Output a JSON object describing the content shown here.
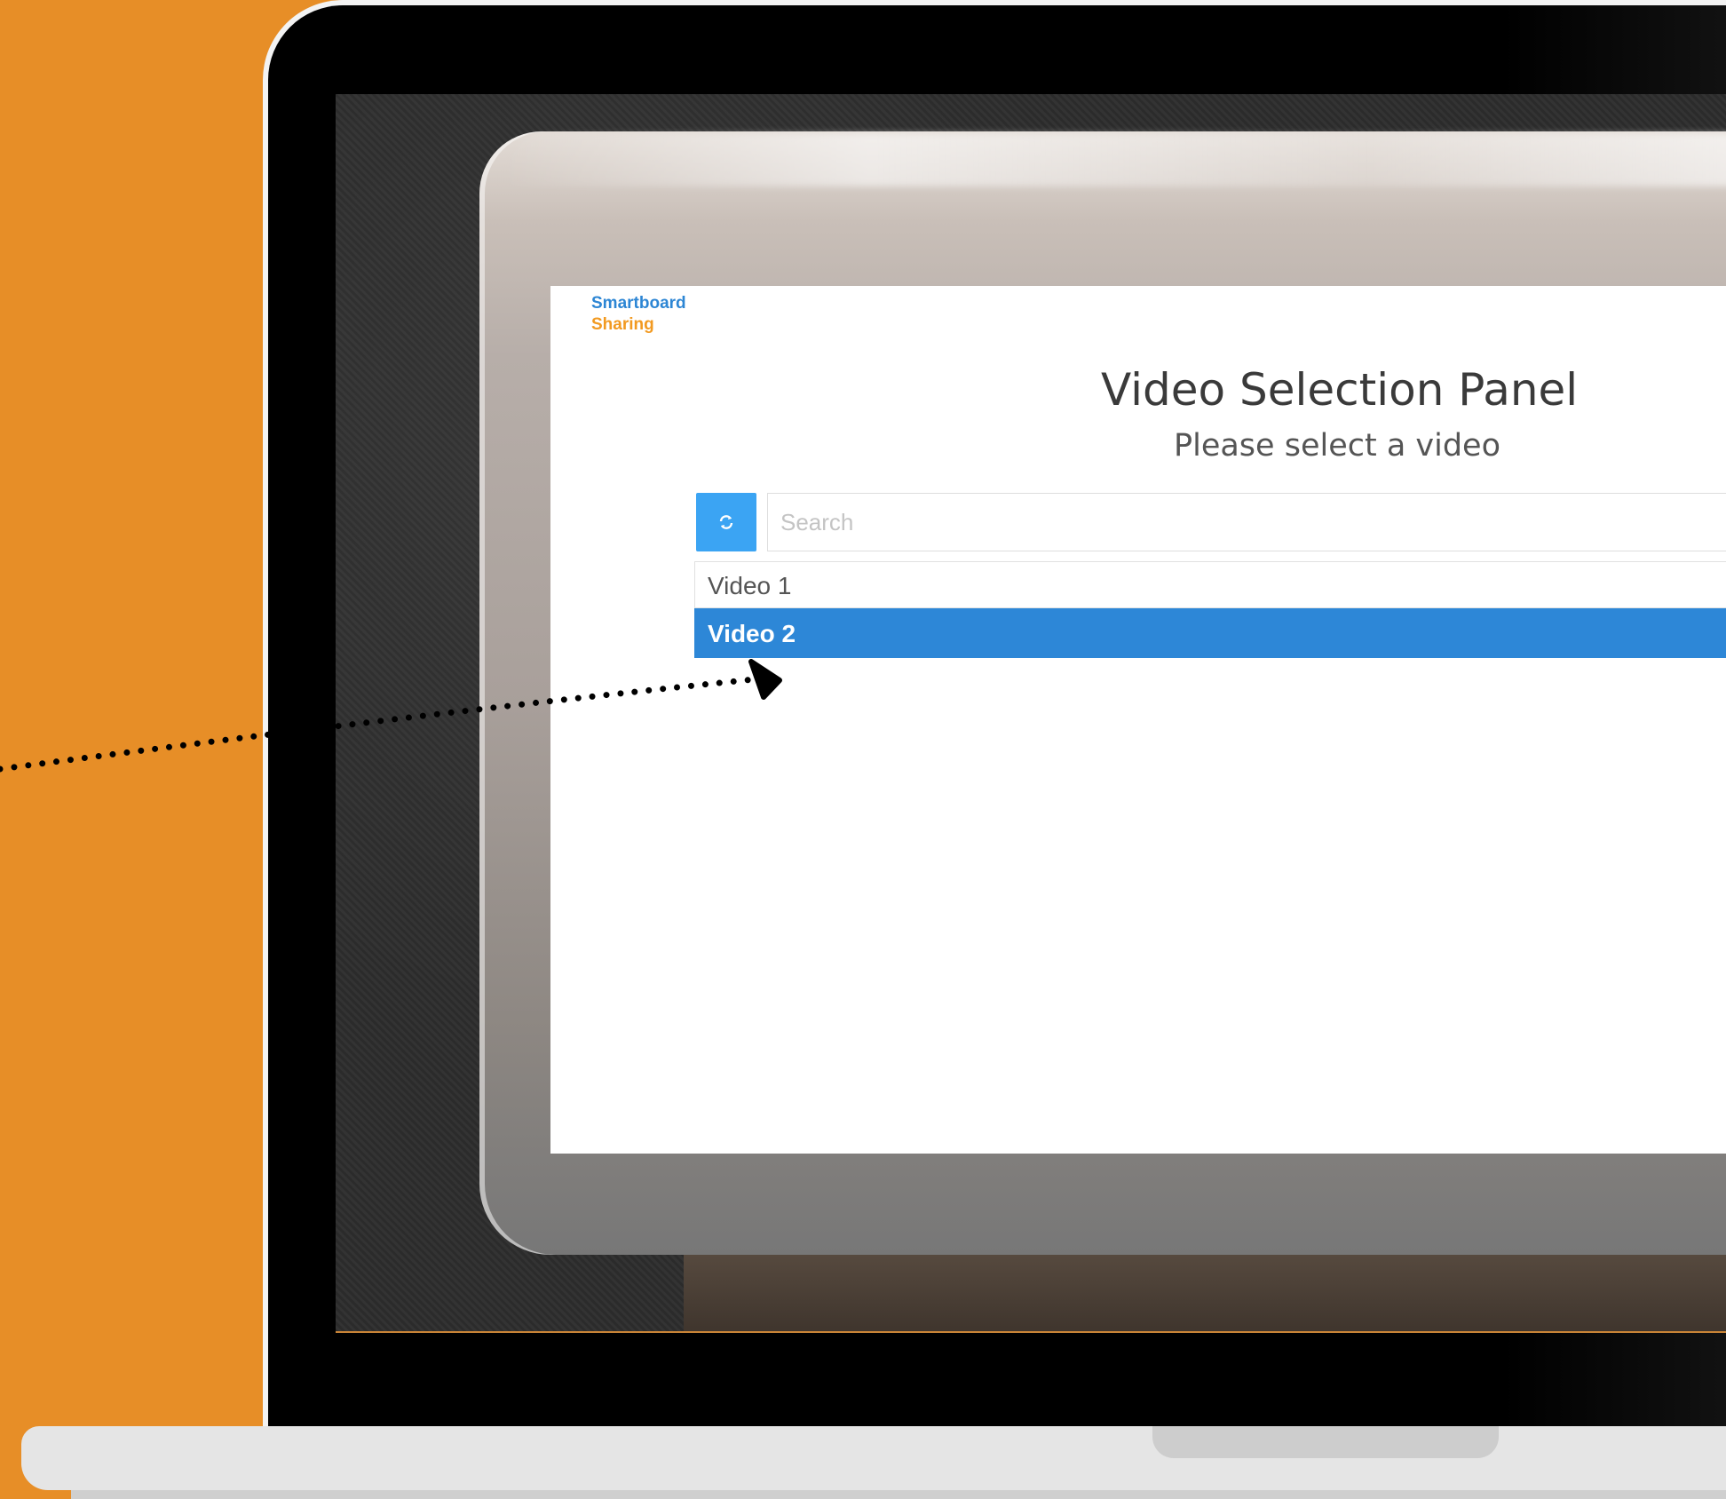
{
  "app": {
    "logo_line1": "Smartboard",
    "logo_line2": "Sharing"
  },
  "panel": {
    "title": "Video Selection Panel",
    "subtitle": "Please select a video"
  },
  "search": {
    "placeholder": "Search",
    "value": ""
  },
  "toolbar": {
    "refresh_icon": "refresh-icon"
  },
  "videos": [
    {
      "label": "Video 1",
      "selected": false
    },
    {
      "label": "Video 2",
      "selected": true
    }
  ],
  "colors": {
    "background": "#e78e27",
    "accent": "#2d87d7",
    "button": "#3ba4f3",
    "logo_blue": "#2d86d4",
    "logo_orange": "#f29a21"
  }
}
